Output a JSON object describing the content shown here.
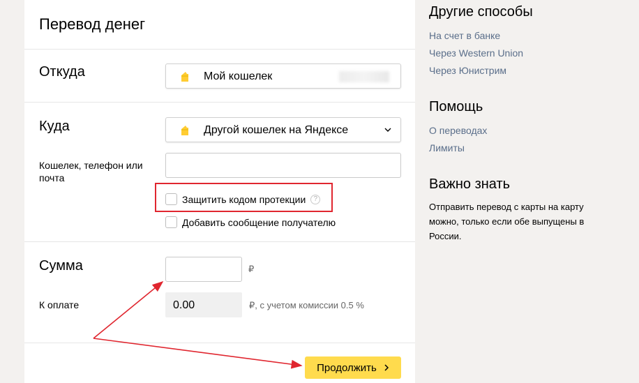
{
  "form": {
    "title": "Перевод денег",
    "from": {
      "label": "Откуда",
      "wallet": "Мой кошелек"
    },
    "to": {
      "label": "Куда",
      "wallet": "Другой кошелек на Яндексе",
      "recipient_label": "Кошелек, телефон или почта",
      "recipient_value": "",
      "protect_label": "Защитить кодом протекции",
      "message_label": "Добавить сообщение получателю"
    },
    "amount": {
      "label": "Сумма",
      "value": "",
      "currency": "₽",
      "pay_label": "К оплате",
      "pay_value": "0.00",
      "pay_note": "₽, с учетом комиссии 0.5 %"
    },
    "submit_label": "Продолжить"
  },
  "sidebar": {
    "other_title": "Другие способы",
    "other_links": [
      "На счет в банке",
      "Через Western Union",
      "Через Юнистрим"
    ],
    "help_title": "Помощь",
    "help_links": [
      "О переводах",
      "Лимиты"
    ],
    "important_title": "Важно знать",
    "important_text": "Отправить перевод с карты на карту можно, только если обе выпущены в России."
  },
  "colors": {
    "accent": "#ffdb4d",
    "link": "#5a6e8a",
    "highlight": "#e0262f"
  },
  "icons": {
    "wallet": "wallet-icon",
    "chevron": "chevron-down-icon",
    "help": "help-icon",
    "submit_arrow": "chevron-right-icon"
  }
}
